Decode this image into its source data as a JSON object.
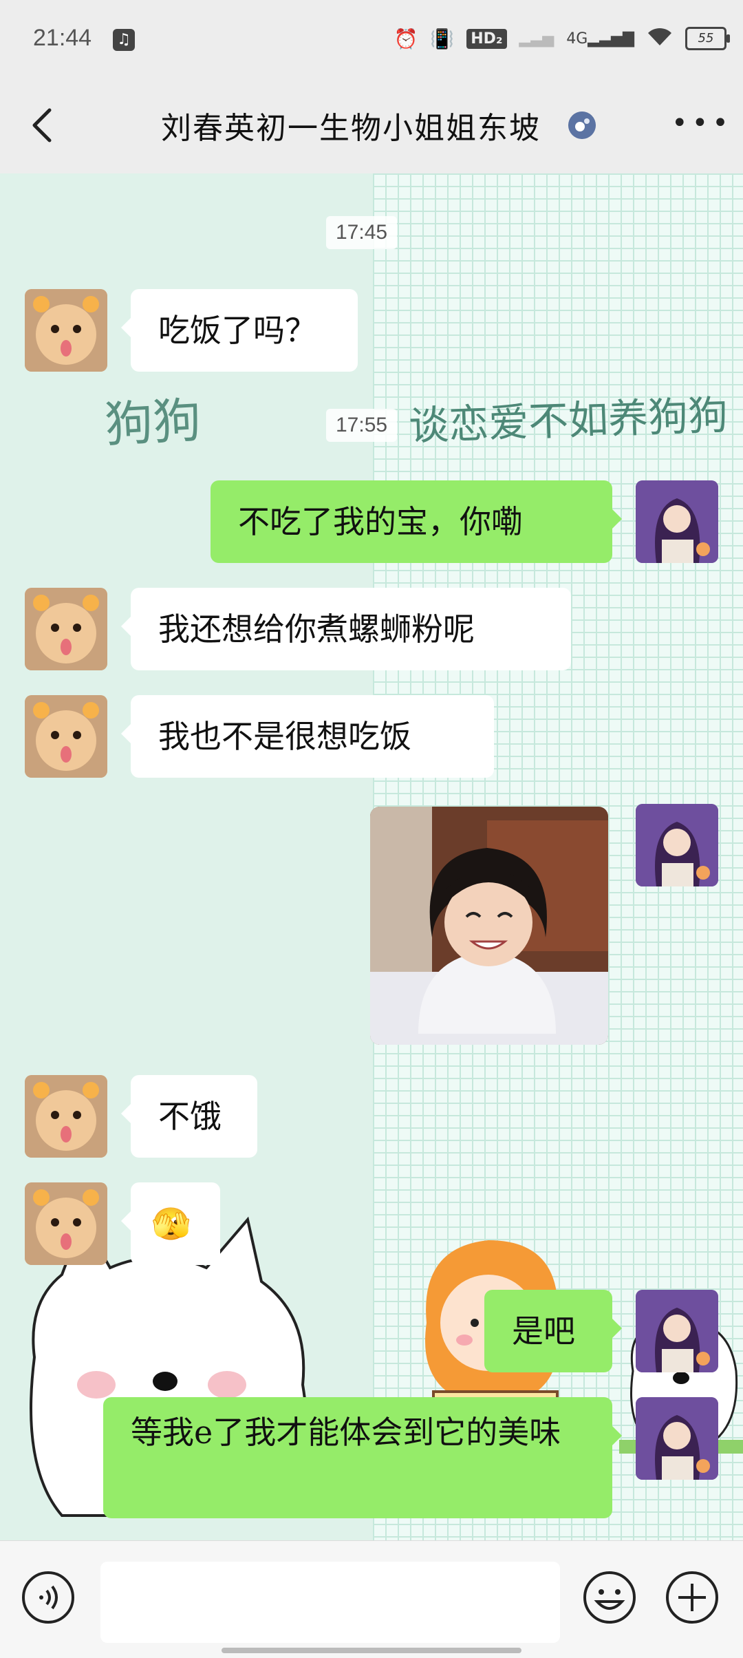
{
  "status": {
    "time": "21:44",
    "battery": "55"
  },
  "header": {
    "title": "刘春英初一生物小姐姐东坡"
  },
  "wallpaper": {
    "text_left": "狗狗",
    "text_right": "谈恋爱不如养狗狗"
  },
  "timestamps": [
    "17:45",
    "17:55"
  ],
  "messages": [
    {
      "side": "left",
      "text": "吃饭了吗？"
    },
    {
      "side": "right",
      "text": "不吃了我的宝，你嘞"
    },
    {
      "side": "left",
      "text": "我还想给你煮螺蛳粉呢"
    },
    {
      "side": "left",
      "text": "我也不是很想吃饭"
    },
    {
      "side": "right",
      "type": "image",
      "description": "smiling-child-photo"
    },
    {
      "side": "left",
      "text": "不饿"
    },
    {
      "side": "left",
      "text": "🫣"
    },
    {
      "side": "right",
      "text": "是吧"
    },
    {
      "side": "right",
      "text": "等我e了我才能体会到它的美味"
    }
  ],
  "input": {
    "placeholder": ""
  },
  "colors": {
    "bubble_right": "#95ec69",
    "bubble_left": "#ffffff",
    "chat_bg": "#dff2ea"
  }
}
